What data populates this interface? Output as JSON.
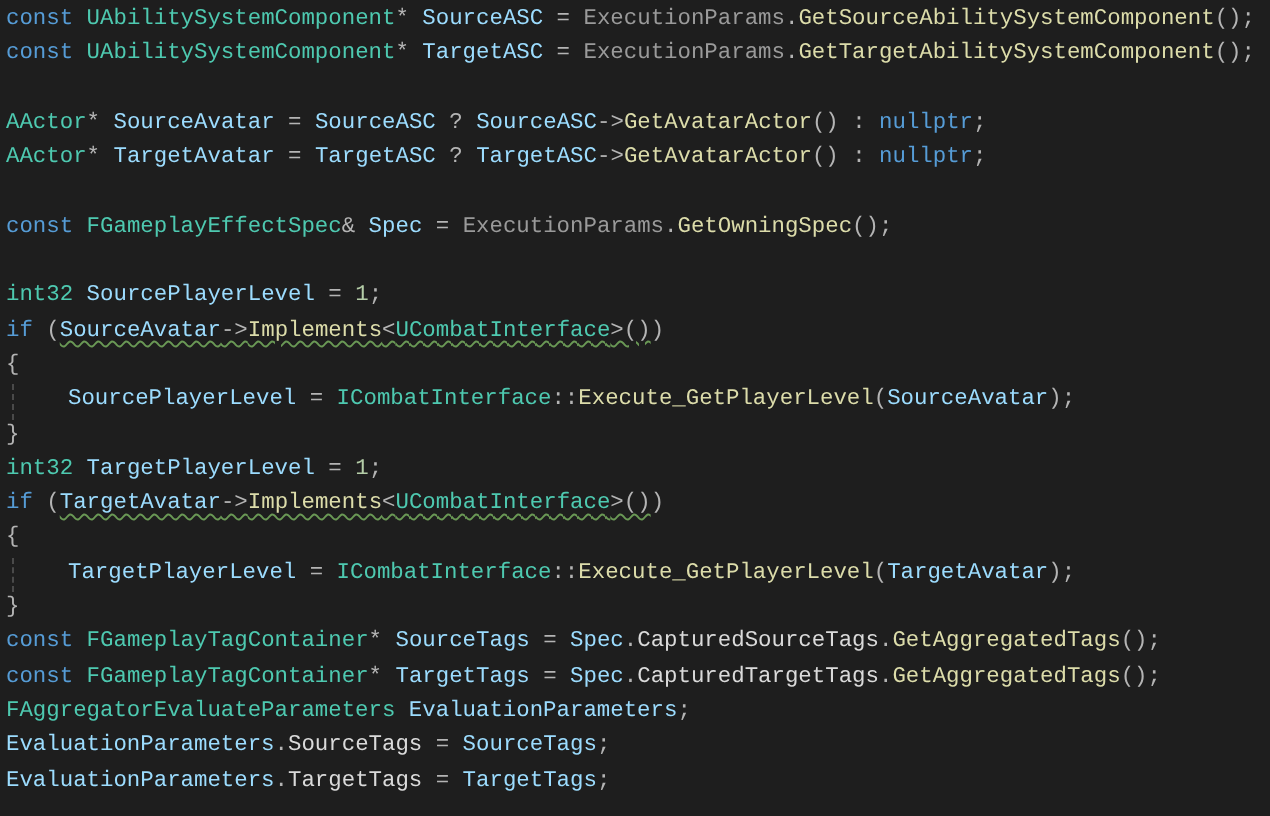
{
  "editor": {
    "blocks": [
      {
        "lines": [
          {
            "tokens": [
              {
                "text": "const ",
                "kind": "keyword"
              },
              {
                "text": "UAbilitySystemComponent",
                "kind": "type"
              },
              {
                "text": "* ",
                "kind": "plain"
              },
              {
                "text": "SourceASC",
                "kind": "variable"
              },
              {
                "text": " = ",
                "kind": "plain"
              },
              {
                "text": "ExecutionParams",
                "kind": "parameter"
              },
              {
                "text": ".",
                "kind": "plain"
              },
              {
                "text": "GetSourceAbilitySystemComponent",
                "kind": "function"
              },
              {
                "text": "();",
                "kind": "plain"
              }
            ]
          },
          {
            "tokens": [
              {
                "text": "const ",
                "kind": "keyword"
              },
              {
                "text": "UAbilitySystemComponent",
                "kind": "type"
              },
              {
                "text": "* ",
                "kind": "plain"
              },
              {
                "text": "TargetASC",
                "kind": "variable"
              },
              {
                "text": " = ",
                "kind": "plain"
              },
              {
                "text": "ExecutionParams",
                "kind": "parameter"
              },
              {
                "text": ".",
                "kind": "plain"
              },
              {
                "text": "GetTargetAbilitySystemComponent",
                "kind": "function"
              },
              {
                "text": "();",
                "kind": "plain"
              }
            ]
          }
        ]
      },
      {
        "lines": [
          {
            "tokens": [
              {
                "text": "AActor",
                "kind": "type"
              },
              {
                "text": "* ",
                "kind": "plain"
              },
              {
                "text": "SourceAvatar",
                "kind": "variable"
              },
              {
                "text": " = ",
                "kind": "plain"
              },
              {
                "text": "SourceASC",
                "kind": "variable"
              },
              {
                "text": " ? ",
                "kind": "plain"
              },
              {
                "text": "SourceASC",
                "kind": "variable"
              },
              {
                "text": "->",
                "kind": "plain"
              },
              {
                "text": "GetAvatarActor",
                "kind": "function"
              },
              {
                "text": "() : ",
                "kind": "plain"
              },
              {
                "text": "nullptr",
                "kind": "keyword"
              },
              {
                "text": ";",
                "kind": "plain"
              }
            ]
          },
          {
            "tokens": [
              {
                "text": "AActor",
                "kind": "type"
              },
              {
                "text": "* ",
                "kind": "plain"
              },
              {
                "text": "TargetAvatar",
                "kind": "variable"
              },
              {
                "text": " = ",
                "kind": "plain"
              },
              {
                "text": "TargetASC",
                "kind": "variable"
              },
              {
                "text": " ? ",
                "kind": "plain"
              },
              {
                "text": "TargetASC",
                "kind": "variable"
              },
              {
                "text": "->",
                "kind": "plain"
              },
              {
                "text": "GetAvatarActor",
                "kind": "function"
              },
              {
                "text": "() : ",
                "kind": "plain"
              },
              {
                "text": "nullptr",
                "kind": "keyword"
              },
              {
                "text": ";",
                "kind": "plain"
              }
            ]
          }
        ]
      },
      {
        "lines": [
          {
            "tokens": [
              {
                "text": "const ",
                "kind": "keyword"
              },
              {
                "text": "FGameplayEffectSpec",
                "kind": "type"
              },
              {
                "text": "& ",
                "kind": "plain"
              },
              {
                "text": "Spec",
                "kind": "variable"
              },
              {
                "text": " = ",
                "kind": "plain"
              },
              {
                "text": "ExecutionParams",
                "kind": "parameter"
              },
              {
                "text": ".",
                "kind": "plain"
              },
              {
                "text": "GetOwningSpec",
                "kind": "function"
              },
              {
                "text": "();",
                "kind": "plain"
              }
            ]
          }
        ]
      },
      {
        "lines": [
          {
            "tokens": [
              {
                "text": "int32 ",
                "kind": "type"
              },
              {
                "text": "SourcePlayerLevel",
                "kind": "variable"
              },
              {
                "text": " = ",
                "kind": "plain"
              },
              {
                "text": "1",
                "kind": "number"
              },
              {
                "text": ";",
                "kind": "plain"
              }
            ]
          },
          {
            "tokens": [
              {
                "text": "if",
                "kind": "keyword"
              },
              {
                "text": " (",
                "kind": "plain"
              }
            ],
            "warning_tokens": [
              {
                "text": "SourceAvatar",
                "kind": "variable"
              },
              {
                "text": "->",
                "kind": "plain"
              },
              {
                "text": "Implements",
                "kind": "function"
              },
              {
                "text": "<",
                "kind": "plain"
              },
              {
                "text": "UCombatInterface",
                "kind": "type"
              },
              {
                "text": ">()",
                "kind": "plain"
              }
            ],
            "tail_tokens": [
              {
                "text": ")",
                "kind": "plain"
              }
            ],
            "warning": true
          },
          {
            "tokens": [
              {
                "text": "{",
                "kind": "plain"
              }
            ],
            "children": [
              {
                "tokens": [
                  {
                    "text": "SourcePlayerLevel",
                    "kind": "variable"
                  },
                  {
                    "text": " = ",
                    "kind": "plain"
                  },
                  {
                    "text": "ICombatInterface",
                    "kind": "type"
                  },
                  {
                    "text": "::",
                    "kind": "plain"
                  },
                  {
                    "text": "Execute_GetPlayerLevel",
                    "kind": "function"
                  },
                  {
                    "text": "(",
                    "kind": "plain"
                  },
                  {
                    "text": "SourceAvatar",
                    "kind": "variable"
                  },
                  {
                    "text": ");",
                    "kind": "plain"
                  }
                ]
              }
            ]
          },
          {
            "tokens": [
              {
                "text": "}",
                "kind": "plain"
              }
            ]
          },
          {
            "tokens": [
              {
                "text": "int32 ",
                "kind": "type"
              },
              {
                "text": "TargetPlayerLevel",
                "kind": "variable"
              },
              {
                "text": " = ",
                "kind": "plain"
              },
              {
                "text": "1",
                "kind": "number"
              },
              {
                "text": ";",
                "kind": "plain"
              }
            ]
          },
          {
            "tokens": [
              {
                "text": "if",
                "kind": "keyword"
              },
              {
                "text": " (",
                "kind": "plain"
              }
            ],
            "warning_tokens": [
              {
                "text": "TargetAvatar",
                "kind": "variable"
              },
              {
                "text": "->",
                "kind": "plain"
              },
              {
                "text": "Implements",
                "kind": "function"
              },
              {
                "text": "<",
                "kind": "plain"
              },
              {
                "text": "UCombatInterface",
                "kind": "type"
              },
              {
                "text": ">()",
                "kind": "plain"
              }
            ],
            "tail_tokens": [
              {
                "text": ")",
                "kind": "plain"
              }
            ],
            "warning": true
          },
          {
            "tokens": [
              {
                "text": "{",
                "kind": "plain"
              }
            ],
            "children": [
              {
                "tokens": [
                  {
                    "text": "TargetPlayerLevel",
                    "kind": "variable"
                  },
                  {
                    "text": " = ",
                    "kind": "plain"
                  },
                  {
                    "text": "ICombatInterface",
                    "kind": "type"
                  },
                  {
                    "text": "::",
                    "kind": "plain"
                  },
                  {
                    "text": "Execute_GetPlayerLevel",
                    "kind": "function"
                  },
                  {
                    "text": "(",
                    "kind": "plain"
                  },
                  {
                    "text": "TargetAvatar",
                    "kind": "variable"
                  },
                  {
                    "text": ");",
                    "kind": "plain"
                  }
                ]
              }
            ]
          },
          {
            "tokens": [
              {
                "text": "}",
                "kind": "plain"
              }
            ]
          },
          {
            "tokens": [
              {
                "text": "const ",
                "kind": "keyword"
              },
              {
                "text": "FGameplayTagContainer",
                "kind": "type"
              },
              {
                "text": "* ",
                "kind": "plain"
              },
              {
                "text": "SourceTags",
                "kind": "variable"
              },
              {
                "text": " = ",
                "kind": "plain"
              },
              {
                "text": "Spec",
                "kind": "variable"
              },
              {
                "text": ".",
                "kind": "plain"
              },
              {
                "text": "CapturedSourceTags",
                "kind": "member"
              },
              {
                "text": ".",
                "kind": "plain"
              },
              {
                "text": "GetAggregatedTags",
                "kind": "function"
              },
              {
                "text": "();",
                "kind": "plain"
              }
            ]
          },
          {
            "tokens": [
              {
                "text": "const ",
                "kind": "keyword"
              },
              {
                "text": "FGameplayTagContainer",
                "kind": "type"
              },
              {
                "text": "* ",
                "kind": "plain"
              },
              {
                "text": "TargetTags",
                "kind": "variable"
              },
              {
                "text": " = ",
                "kind": "plain"
              },
              {
                "text": "Spec",
                "kind": "variable"
              },
              {
                "text": ".",
                "kind": "plain"
              },
              {
                "text": "CapturedTargetTags",
                "kind": "member"
              },
              {
                "text": ".",
                "kind": "plain"
              },
              {
                "text": "GetAggregatedTags",
                "kind": "function"
              },
              {
                "text": "();",
                "kind": "plain"
              }
            ]
          },
          {
            "tokens": [
              {
                "text": "FAggregatorEvaluateParameters ",
                "kind": "type"
              },
              {
                "text": "EvaluationParameters",
                "kind": "variable"
              },
              {
                "text": ";",
                "kind": "plain"
              }
            ]
          },
          {
            "tokens": [
              {
                "text": "EvaluationParameters",
                "kind": "variable"
              },
              {
                "text": ".",
                "kind": "plain"
              },
              {
                "text": "SourceTags",
                "kind": "member"
              },
              {
                "text": " = ",
                "kind": "plain"
              },
              {
                "text": "SourceTags",
                "kind": "variable"
              },
              {
                "text": ";",
                "kind": "plain"
              }
            ]
          },
          {
            "tokens": [
              {
                "text": "EvaluationParameters",
                "kind": "variable"
              },
              {
                "text": ".",
                "kind": "plain"
              },
              {
                "text": "TargetTags",
                "kind": "member"
              },
              {
                "text": " = ",
                "kind": "plain"
              },
              {
                "text": "TargetTags",
                "kind": "variable"
              },
              {
                "text": ";",
                "kind": "plain"
              }
            ]
          }
        ]
      }
    ]
  }
}
